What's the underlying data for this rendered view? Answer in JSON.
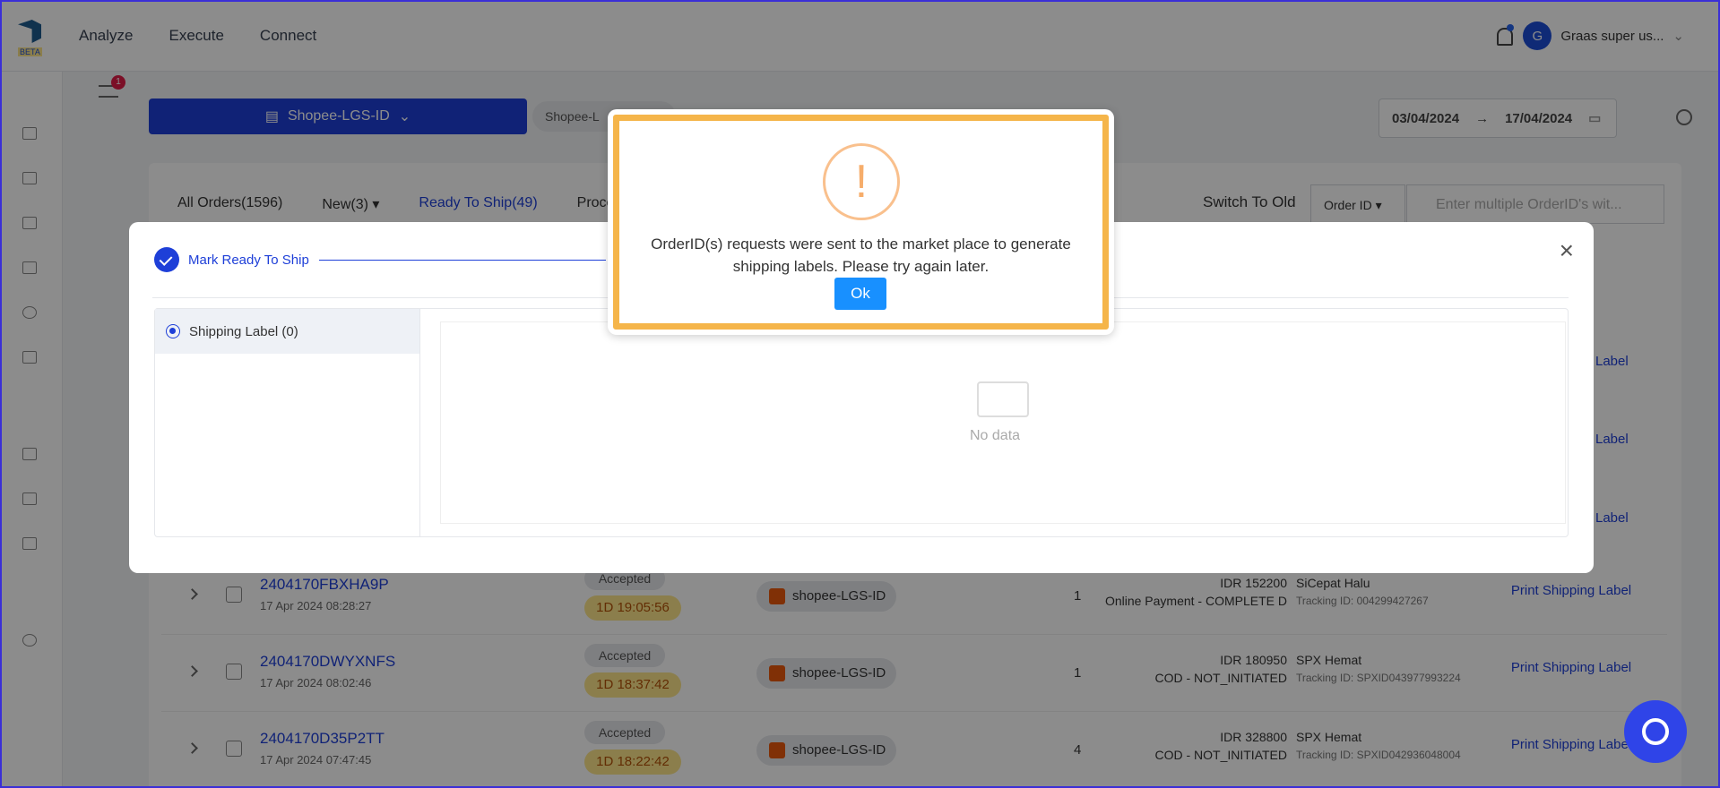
{
  "app": {
    "beta_label": "BETA"
  },
  "nav": {
    "items": [
      "Analyze",
      "Execute",
      "Connect"
    ]
  },
  "user": {
    "initial": "G",
    "name": "Graas super us..."
  },
  "filter": {
    "badge": "1"
  },
  "store_selector": {
    "label": "Shopee-LGS-ID"
  },
  "chip": {
    "label": "Shopee-L"
  },
  "date_range": {
    "start": "03/04/2024",
    "arrow": "→",
    "end": "17/04/2024"
  },
  "tabs": [
    {
      "label": "All Orders(1596)"
    },
    {
      "label": "New(3) ▾"
    },
    {
      "label": "Ready To Ship(49)"
    },
    {
      "label": "Proce"
    }
  ],
  "switch_old": {
    "label": "Switch To Old"
  },
  "search": {
    "type": "Order ID ▾",
    "placeholder": "Enter multiple OrderID's wit..."
  },
  "rows": [
    {
      "order_id": "2404170FBXHA9P",
      "date": "17 Apr 2024 08:28:27",
      "status": "Accepted",
      "sla": "1D 19:05:56",
      "store": "shopee-LGS-ID",
      "qty": "1",
      "amount": "IDR 152200",
      "payment": "Online Payment - COMPLETE D",
      "carrier": "SiCepat Halu",
      "tracking": "Tracking ID: 004299427267",
      "action": "Print Shipping Label"
    },
    {
      "order_id": "2404170DWYXNFS",
      "date": "17 Apr 2024 08:02:46",
      "status": "Accepted",
      "sla": "1D 18:37:42",
      "store": "shopee-LGS-ID",
      "qty": "1",
      "amount": "IDR 180950",
      "payment": "COD - NOT_INITIATED",
      "carrier": "SPX Hemat",
      "tracking": "Tracking ID: SPXID043977993224",
      "action": "Print Shipping Label"
    },
    {
      "order_id": "2404170D35P2TT",
      "date": "17 Apr 2024 07:47:45",
      "status": "Accepted",
      "sla": "1D 18:22:42",
      "store": "shopee-LGS-ID",
      "qty": "4",
      "amount": "IDR 328800",
      "payment": "COD - NOT_INITIATED",
      "carrier": "SPX Hemat",
      "tracking": "Tracking ID: SPXID042936048004",
      "action": "Print Shipping Label"
    }
  ],
  "bg_actions": {
    "label": "Label"
  },
  "modal": {
    "step_label": "Mark Ready To Ship",
    "left_item": "Shipping Label (0)",
    "empty_text": "No data",
    "close": "×"
  },
  "alert": {
    "icon": "!",
    "message_line1": "OrderID(s) requests were sent to the market place to generate",
    "message_line2": "shipping labels. Please try again later.",
    "ok_label": "Ok"
  }
}
